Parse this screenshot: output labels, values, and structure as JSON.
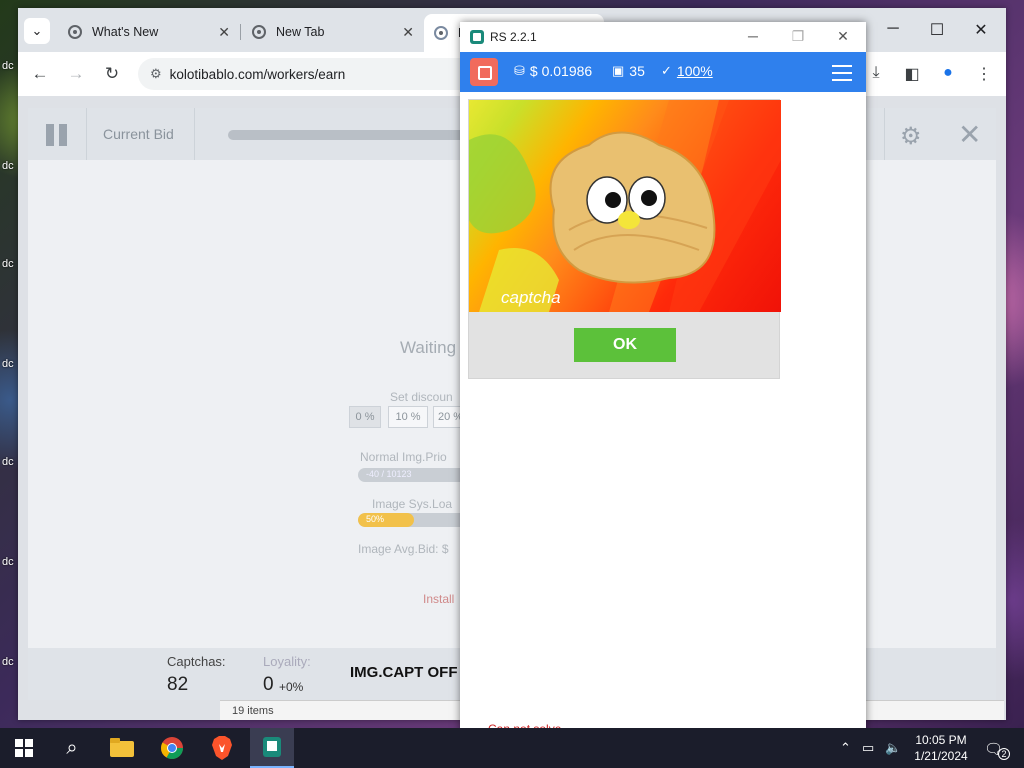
{
  "browser": {
    "tabs": [
      {
        "label": "What's New"
      },
      {
        "label": "New Tab"
      },
      {
        "label": "K"
      }
    ],
    "url": "kolotibablo.com/workers/earn"
  },
  "page": {
    "current_bid_label": "Current Bid",
    "waiting_text": "Waiting",
    "set_discount_label": "Set discoun",
    "discount_options": [
      "0 %",
      "10 %",
      "20 %"
    ],
    "normal_img_label": "Normal Img.Prio",
    "normal_img_bar_text": "-40 / 10123",
    "image_sys_load_label": "Image Sys.Loa",
    "image_sys_load_bar_text": "50%",
    "image_sys_load_fraction": 0.5,
    "image_avg_bid_label": "Image Avg.Bid: $",
    "install_link": "Install",
    "stats": {
      "captchas_label": "Captchas:",
      "captchas_value": "82",
      "loyality_label": "Loyality:",
      "loyality_value": "0",
      "loyality_change": "+0%"
    },
    "img_capt_status": "IMG.CAPT OFF"
  },
  "items_strip": "19 items",
  "rs_popup": {
    "title": "RS 2.2.1",
    "balance": "$ 0.01986",
    "images_count": "35",
    "accuracy": "100%",
    "captcha_logo_text": "captcha",
    "ok_button": "OK",
    "footer_text": "Can not solve"
  },
  "taskbar": {
    "time": "10:05 PM",
    "date": "1/21/2024",
    "notification_count": "2"
  },
  "colors": {
    "rs_bar": "#2f80ed",
    "ok_green": "#5cc13a",
    "stop_red": "#f16b5c"
  }
}
